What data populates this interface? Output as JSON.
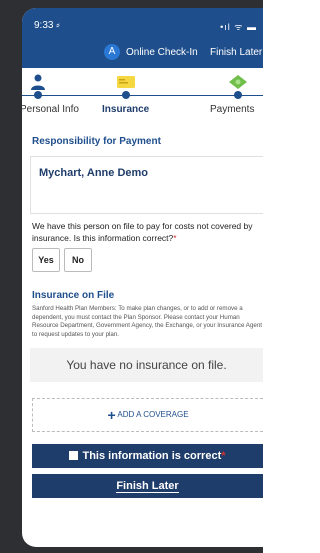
{
  "status": {
    "time": "9:33 ⸗",
    "indicators": "•ıl ᯤ ▬"
  },
  "header": {
    "avatar_letter": "A",
    "title": "Online Check-In",
    "finish_later": "Finish Later"
  },
  "steps": [
    {
      "label": "Personal Info",
      "icon": "person-icon"
    },
    {
      "label": "Insurance",
      "icon": "insurance-card-icon",
      "active": true
    },
    {
      "label": "Payments",
      "icon": "money-icon"
    }
  ],
  "responsibility": {
    "title": "Responsibility for Payment",
    "name": "Mychart, Anne Demo",
    "question": "We have this person on file to pay for costs not covered by insurance. Is this information correct?",
    "required_mark": "*",
    "yes_label": "Yes",
    "no_label": "No"
  },
  "insurance": {
    "title": "Insurance on File",
    "notice": "Sanford Health Plan Members: To make plan changes, or to add or remove a dependent, you must contact the Plan Sponsor. Please contact your Human Resource Department, Government Agency, the Exchange, or your Insurance Agent to request updates to your plan.",
    "empty_message": "You have no insurance on file.",
    "add_label": "ADD A COVERAGE"
  },
  "footer": {
    "confirm_label": "This information is correct",
    "confirm_required": "*",
    "finish_later_label": "Finish Later"
  }
}
